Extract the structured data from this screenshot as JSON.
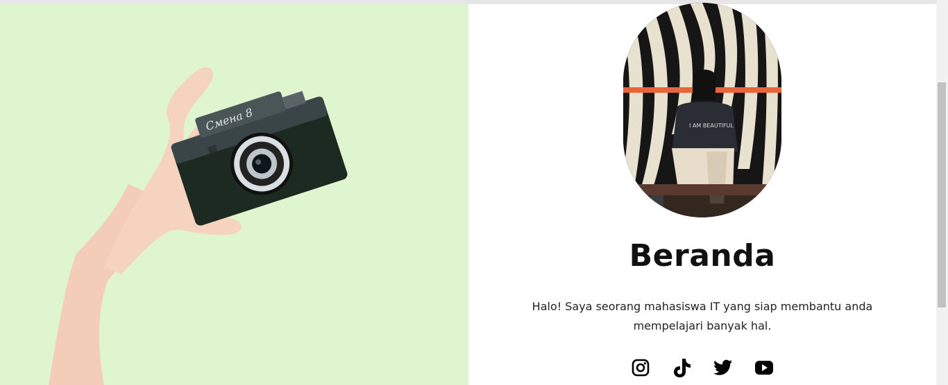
{
  "hero": {
    "image_name": "hand-holding-camera",
    "camera_brand": "Смена 8",
    "background_color": "#dff5cf"
  },
  "profile": {
    "image_name": "profile-photo",
    "shirt_text": "I AM BEAUTIFUL"
  },
  "page": {
    "title": "Beranda",
    "intro": "Halo! Saya seorang mahasiswa IT yang siap membantu anda mempelajari banyak hal."
  },
  "socials": [
    {
      "name": "instagram-icon"
    },
    {
      "name": "tiktok-icon"
    },
    {
      "name": "twitter-icon"
    },
    {
      "name": "youtube-icon"
    }
  ],
  "colors": {
    "text": "#111111",
    "accent_orange": "#e8643c"
  }
}
